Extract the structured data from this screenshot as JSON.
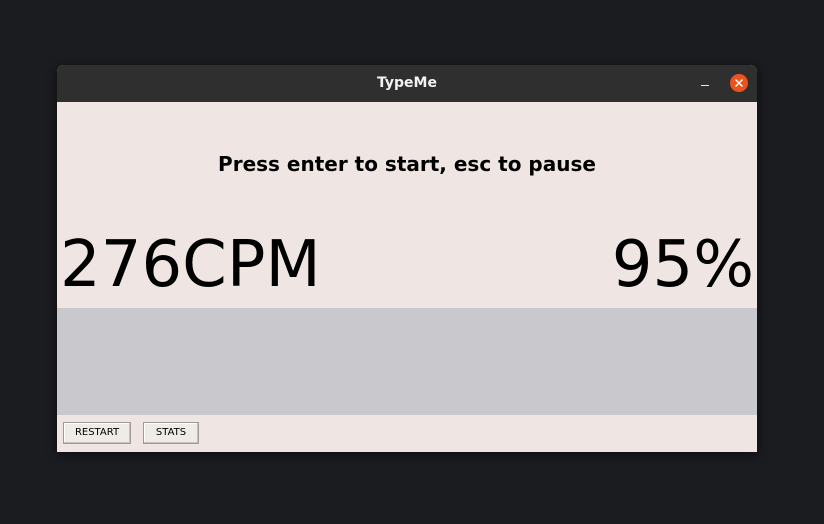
{
  "window": {
    "title": "TypeMe"
  },
  "main": {
    "prompt": "Press enter to start, esc to pause",
    "speed": "276CPM",
    "accuracy": "95%"
  },
  "buttons": {
    "restart_label": "RESTART",
    "stats_label": "STATS"
  },
  "icons": {
    "minimize": "minimize-icon",
    "close": "close-icon"
  },
  "colors": {
    "titlebar": "#2f2f2f",
    "close_button": "#e9541f",
    "background": "#efe6e3",
    "typing_area": "#c9c8cc"
  }
}
